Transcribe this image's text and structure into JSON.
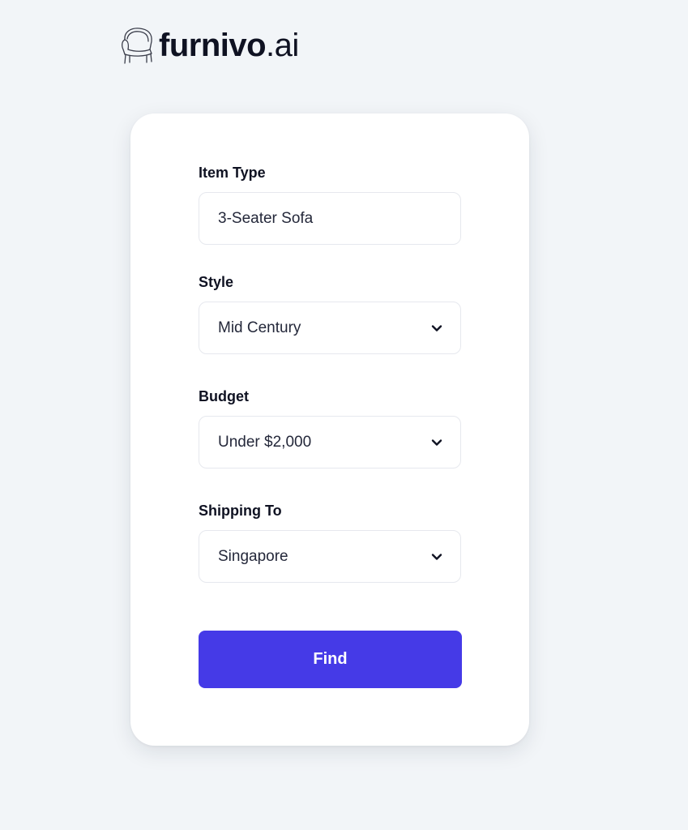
{
  "brand": {
    "name": "furnivo",
    "tld": ".ai",
    "logo_icon": "armchair-icon"
  },
  "form": {
    "item_type": {
      "label": "Item Type",
      "value": "3-Seater Sofa"
    },
    "style": {
      "label": "Style",
      "value": "Mid Century",
      "icon": "chevron-down-icon"
    },
    "budget": {
      "label": "Budget",
      "value": "Under $2,000",
      "icon": "chevron-down-icon"
    },
    "shipping": {
      "label": "Shipping To",
      "value": "Singapore",
      "icon": "chevron-down-icon"
    },
    "submit_label": "Find"
  },
  "colors": {
    "background": "#f2f5f8",
    "card": "#ffffff",
    "accent": "#453ae7",
    "text": "#0f1222"
  }
}
